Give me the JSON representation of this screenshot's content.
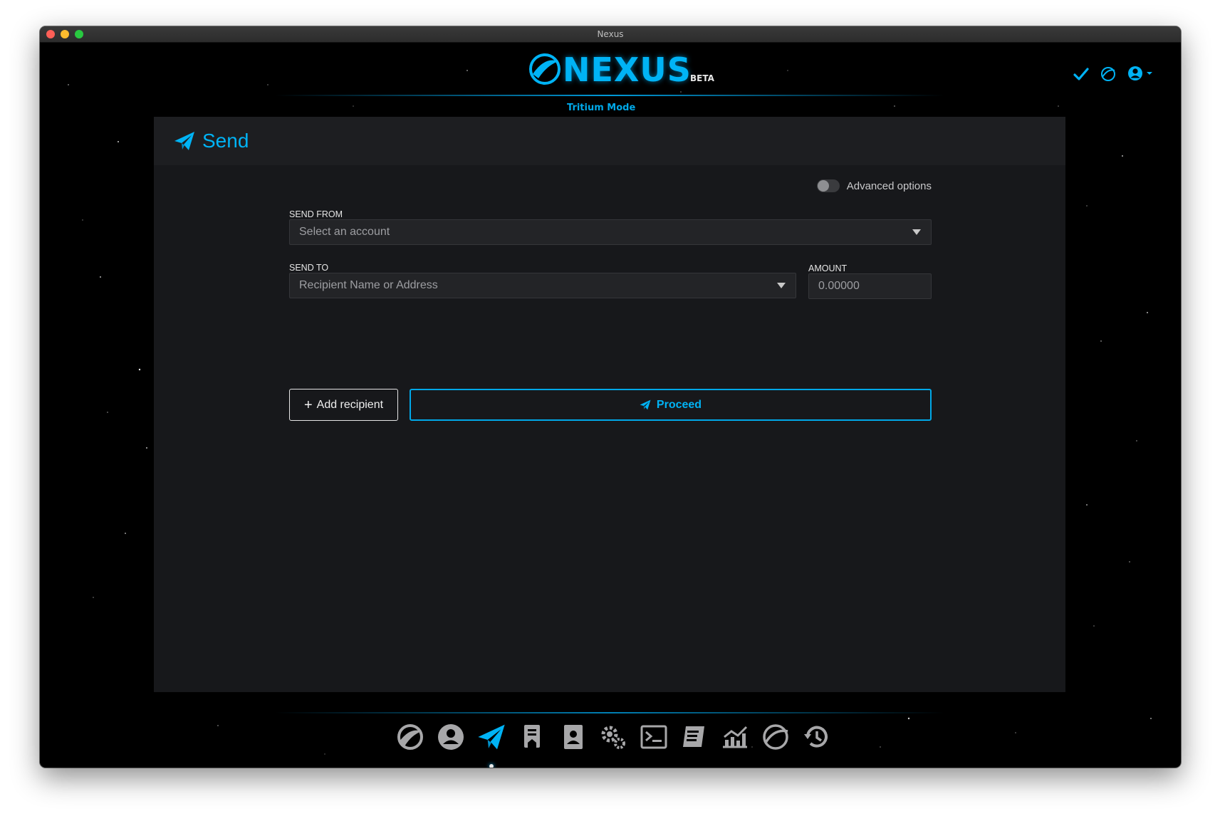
{
  "window": {
    "title": "Nexus"
  },
  "header": {
    "logo_text": "NEXUS",
    "beta_label": "BETA",
    "mode_label": "Tritium Mode",
    "icons": [
      "check-icon",
      "nexus-globe-icon",
      "user-menu-icon"
    ]
  },
  "page": {
    "title": "Send",
    "advanced_options_label": "Advanced options",
    "advanced_options_enabled": false
  },
  "form": {
    "send_from_label": "SEND FROM",
    "send_from_placeholder": "Select an account",
    "send_to_label": "SEND TO",
    "send_to_placeholder": "Recipient Name or Address",
    "amount_label": "AMOUNT",
    "amount_value": "0.00000",
    "add_recipient_label": "Add recipient",
    "proceed_label": "Proceed"
  },
  "dock": {
    "items": [
      "overview-icon",
      "user-icon",
      "send-icon",
      "transactions-icon",
      "address-book-icon",
      "settings-icon",
      "terminal-icon",
      "news-icon",
      "market-icon",
      "nexus-globe-icon",
      "history-icon"
    ],
    "active": "send-icon"
  },
  "colors": {
    "accent": "#00b3f5",
    "panel": "#17181b",
    "background": "#000000"
  }
}
